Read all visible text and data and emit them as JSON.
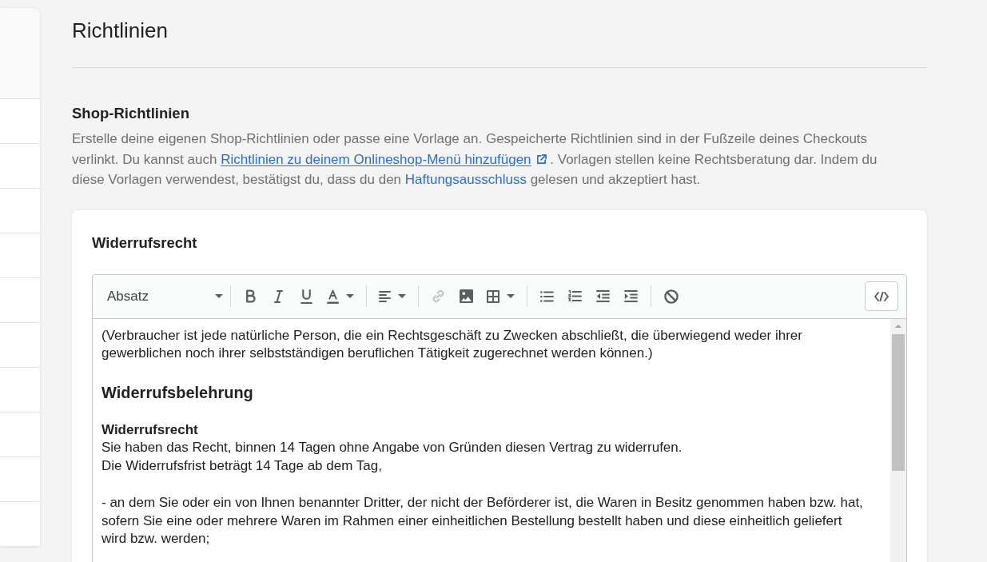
{
  "page": {
    "title": "Richtlinien"
  },
  "section": {
    "title": "Shop-Richtlinien",
    "description": [
      {
        "kind": "text",
        "text": "Erstelle deine eigenen Shop-Richtlinien oder passe eine Vorlage an. Gespeicherte Richtlinien sind in der Fußzeile deines Checkouts verlinkt. Du kannst auch "
      },
      {
        "kind": "external_link",
        "text": "Richtlinien zu deinem Onlineshop-Menü hinzufügen"
      },
      {
        "kind": "text",
        "text": " . Vorlagen stellen keine Rechtsberatung dar. Indem du diese Vorlagen verwendest, bestätigst du, dass du den "
      },
      {
        "kind": "link",
        "text": "Haftungsausschluss"
      },
      {
        "kind": "text",
        "text": " gelesen und akzeptiert hast."
      }
    ]
  },
  "policy_card": {
    "title": "Widerrufsrecht",
    "editor": {
      "toolbar": {
        "format_select": {
          "value": "Absatz"
        },
        "groups": [
          [
            {
              "kind": "bold",
              "disabled": false
            },
            {
              "kind": "italic",
              "disabled": false
            },
            {
              "kind": "underline",
              "disabled": false
            },
            {
              "kind": "text_color",
              "disabled": false
            }
          ],
          [
            {
              "kind": "align",
              "disabled": false
            }
          ],
          [
            {
              "kind": "link",
              "disabled": true
            },
            {
              "kind": "image",
              "disabled": false
            },
            {
              "kind": "table",
              "disabled": false
            }
          ],
          [
            {
              "kind": "bullet_list",
              "disabled": false
            },
            {
              "kind": "numbered_list",
              "disabled": false
            },
            {
              "kind": "outdent",
              "disabled": false
            },
            {
              "kind": "indent",
              "disabled": false
            }
          ],
          [
            {
              "kind": "clear_format",
              "disabled": false
            }
          ]
        ],
        "end_tools": [
          {
            "kind": "code_view",
            "disabled": false
          }
        ]
      },
      "content": [
        {
          "kind": "paragraph",
          "lines": [
            "(Verbraucher ist jede natürliche Person, die ein Rechtsgeschäft zu Zwecken abschließt, die überwiegend weder ihrer gewerblichen noch ihrer selbstständigen beruflichen Tätigkeit zugerechnet werden können.)"
          ]
        },
        {
          "kind": "heading",
          "text": "Widerrufsbelehrung"
        },
        {
          "kind": "subheading",
          "text": "Widerrufsrecht"
        },
        {
          "kind": "paragraph",
          "lines": [
            "Sie haben das Recht, binnen 14 Tagen ohne Angabe von Gründen diesen Vertrag zu widerrufen.",
            "Die Widerrufsfrist beträgt 14 Tage ab dem Tag,"
          ]
        },
        {
          "kind": "paragraph",
          "lines": [
            "- an dem Sie oder ein von Ihnen benannter Dritter, der nicht der Beförderer ist, die Waren in Besitz genommen haben bzw. hat, sofern Sie eine oder mehrere Waren im Rahmen einer einheitlichen Bestellung bestellt haben und diese einheitlich geliefert wird bzw. werden;"
          ]
        }
      ]
    }
  }
}
